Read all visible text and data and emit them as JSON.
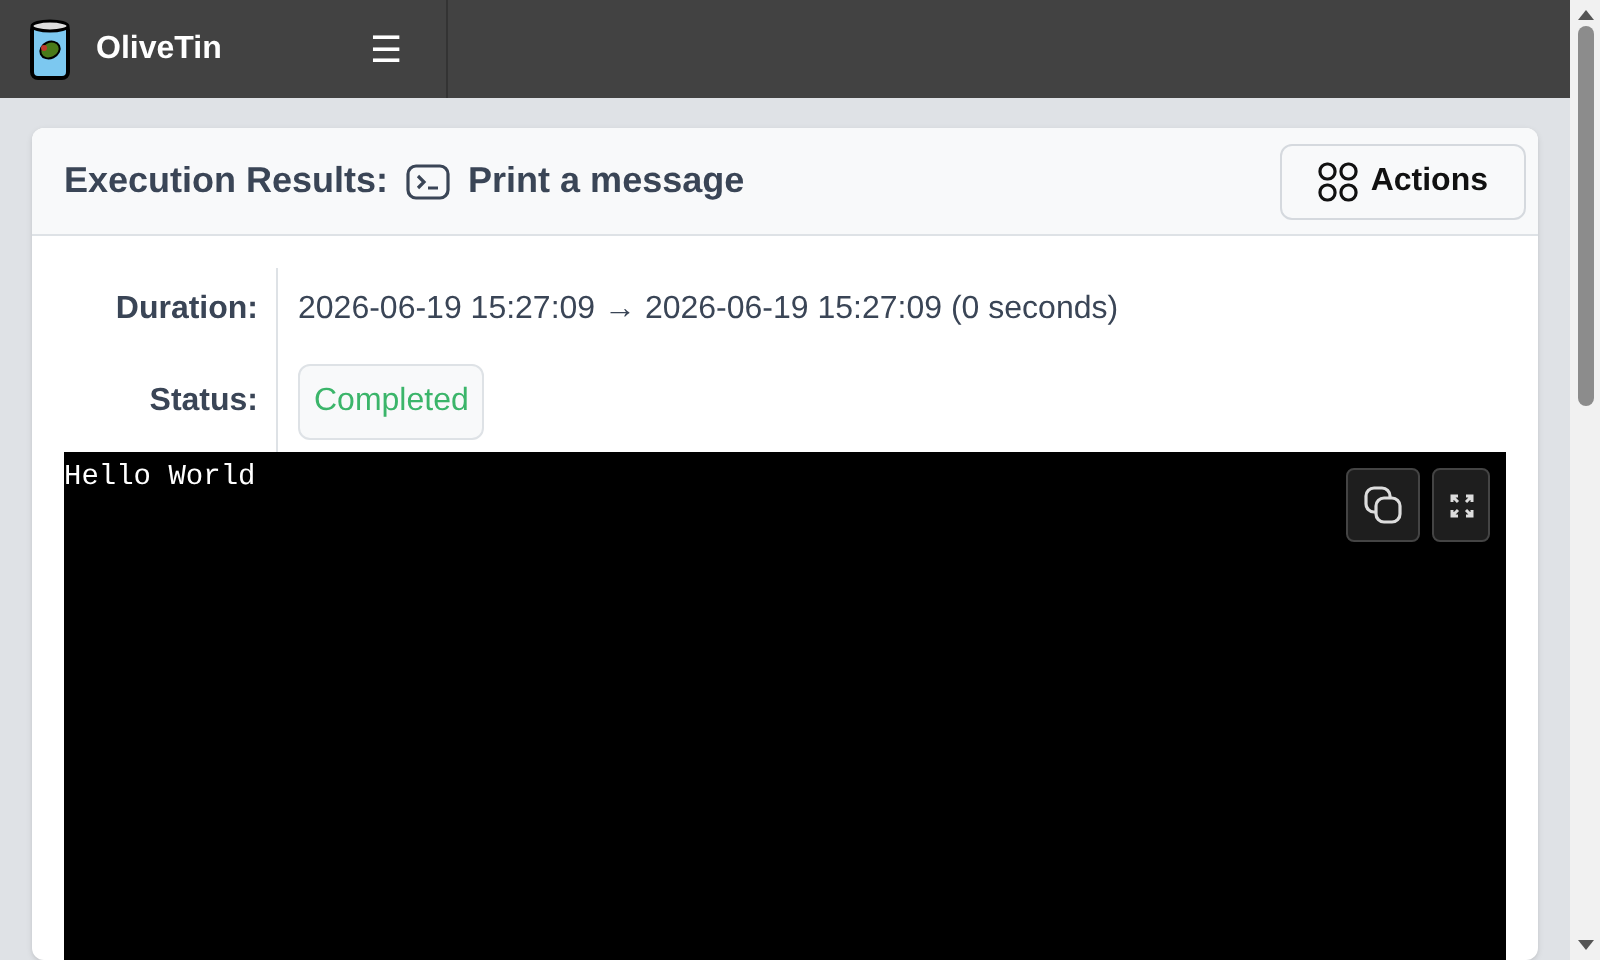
{
  "header": {
    "title": "OliveTin",
    "menu_icon": "☰"
  },
  "card": {
    "title": "Execution Results:",
    "action_title": "Print a message",
    "actions_button": "Actions"
  },
  "details": [
    {
      "label": "Duration:",
      "value": "2026-06-19 15:27:09 → 2026-06-19 15:27:09 (0 seconds)",
      "kind": "text"
    },
    {
      "label": "Status:",
      "value": "Completed",
      "kind": "badge"
    }
  ],
  "output": {
    "text": "Hello World"
  }
}
